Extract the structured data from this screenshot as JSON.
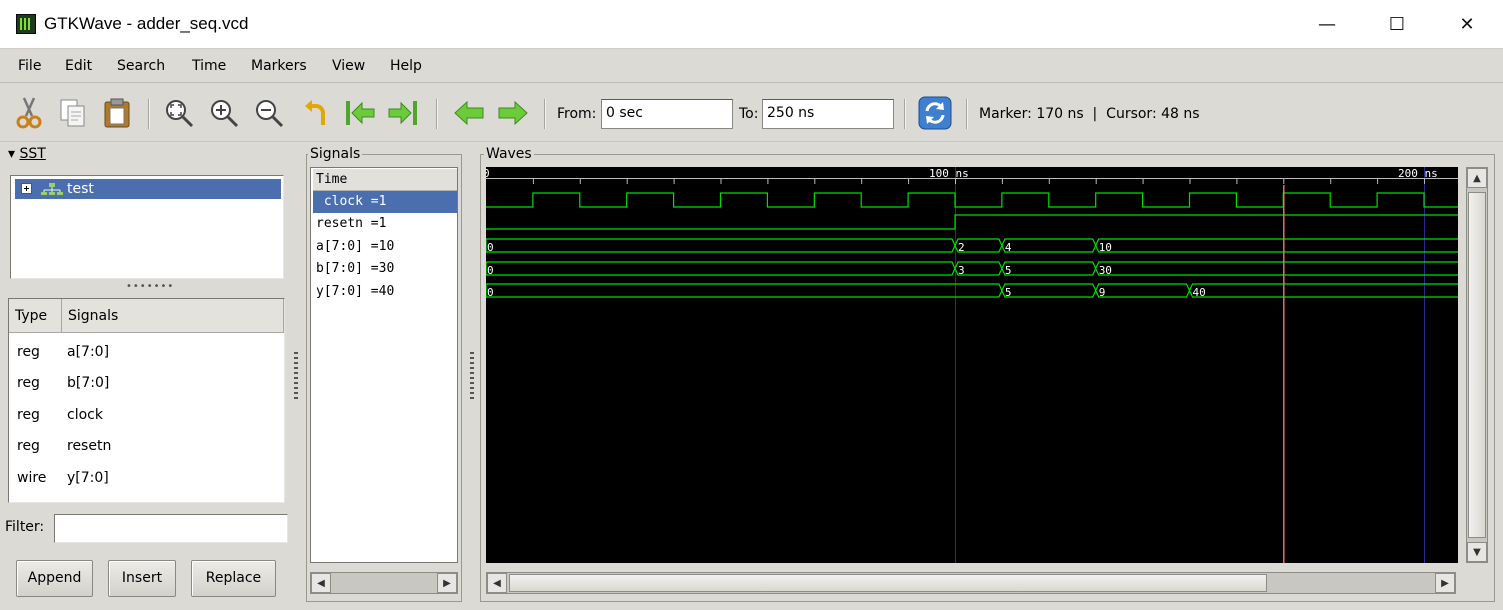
{
  "window": {
    "title": "GTKWave - adder_seq.vcd",
    "minimize_glyph": "—",
    "maximize_glyph": "☐",
    "close_glyph": "✕"
  },
  "menu": [
    "File",
    "Edit",
    "Search",
    "Time",
    "Markers",
    "View",
    "Help"
  ],
  "toolbar": {
    "icons": [
      "cut-icon",
      "copy-icon",
      "paste-icon",
      "zoom-fit-icon",
      "zoom-in-icon",
      "zoom-out-icon",
      "undo-zoom-icon",
      "jump-start-icon",
      "jump-end-icon",
      "prev-edge-icon",
      "next-edge-icon",
      "reload-icon"
    ],
    "from_label": "From:",
    "from_value": "0 sec",
    "to_label": "To:",
    "to_value": "250 ns",
    "status": "Marker: 170 ns  |  Cursor: 48 ns"
  },
  "sst": {
    "title": "SST",
    "tree_item": "test",
    "table_headers": [
      "Type",
      "Signals"
    ],
    "rows": [
      {
        "type": "reg",
        "name": "a[7:0]"
      },
      {
        "type": "reg",
        "name": "b[7:0]"
      },
      {
        "type": "reg",
        "name": "clock"
      },
      {
        "type": "reg",
        "name": "resetn"
      },
      {
        "type": "wire",
        "name": "y[7:0]"
      }
    ],
    "filter_label": "Filter:",
    "filter_value": "",
    "buttons": {
      "append": "Append",
      "insert": "Insert",
      "replace": "Replace"
    }
  },
  "signals": {
    "title": "Signals",
    "header": "Time",
    "rows": [
      " clock =1",
      "resetn =1",
      "a[7:0] =10",
      "b[7:0] =30",
      "y[7:0] =40"
    ],
    "selected_index": 0
  },
  "waves": {
    "title": "Waves",
    "time_range_ns": [
      0,
      208
    ],
    "ticks": [
      {
        "t": 0,
        "label": "0"
      },
      {
        "t": 100,
        "label": "100 ns"
      },
      {
        "t": 200,
        "label": "200 ns"
      }
    ],
    "marker_ns": 170,
    "clock": {
      "period_ns": 20,
      "first_rise_ns": 10
    },
    "resetn": [
      {
        "t": 0,
        "v": 0
      },
      {
        "t": 100,
        "v": 1
      }
    ],
    "buses": [
      {
        "name": "a",
        "segments": [
          {
            "t": 0,
            "label": "0"
          },
          {
            "t": 100,
            "label": "2"
          },
          {
            "t": 110,
            "label": "4"
          },
          {
            "t": 130,
            "label": "10"
          }
        ]
      },
      {
        "name": "b",
        "segments": [
          {
            "t": 0,
            "label": "0"
          },
          {
            "t": 100,
            "label": "3"
          },
          {
            "t": 110,
            "label": "5"
          },
          {
            "t": 130,
            "label": "30"
          }
        ]
      },
      {
        "name": "y",
        "segments": [
          {
            "t": 0,
            "label": "0"
          },
          {
            "t": 110,
            "label": "5"
          },
          {
            "t": 130,
            "label": "9"
          },
          {
            "t": 150,
            "label": "40"
          }
        ]
      }
    ],
    "colors": {
      "signal": "#00e000",
      "marker": "#ff7070",
      "grid": "#2a2a8a",
      "tick": "#ffffff"
    }
  }
}
